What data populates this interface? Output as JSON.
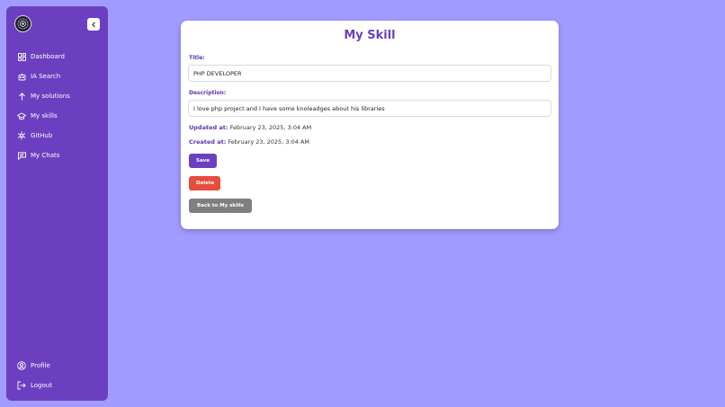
{
  "sidebar": {
    "items": [
      {
        "label": "Dashboard",
        "icon": "dashboard-icon"
      },
      {
        "label": "IA Search",
        "icon": "robot-icon"
      },
      {
        "label": "My solutions",
        "icon": "arrow-up-icon"
      },
      {
        "label": "My skills",
        "icon": "graduation-cap-icon"
      },
      {
        "label": "GitHub",
        "icon": "github-icon"
      },
      {
        "label": "My Chats",
        "icon": "chat-icon"
      }
    ],
    "bottom_items": [
      {
        "label": "Profile",
        "icon": "user-circle-icon"
      },
      {
        "label": "Logout",
        "icon": "logout-icon"
      }
    ]
  },
  "card": {
    "title": "My Skill",
    "title_label": "Title:",
    "title_value": "PHP DEVELOPER",
    "description_label": "Description:",
    "description_value": "I love php project and I have some knoleadges about his libraries",
    "updated_label": "Updated at:",
    "updated_value": "February 23, 2025, 3:04 AM",
    "created_label": "Created at:",
    "created_value": "February 23, 2025, 3:04 AM",
    "save_label": "Save",
    "delete_label": "Delete",
    "back_label": "Back to My skills"
  },
  "colors": {
    "background": "#a29bfe",
    "sidebar": "#6c3fc0",
    "accent": "#6c3fc0",
    "save": "#6c3fc0",
    "delete": "#e74c3c",
    "back": "#7f7f7f"
  }
}
